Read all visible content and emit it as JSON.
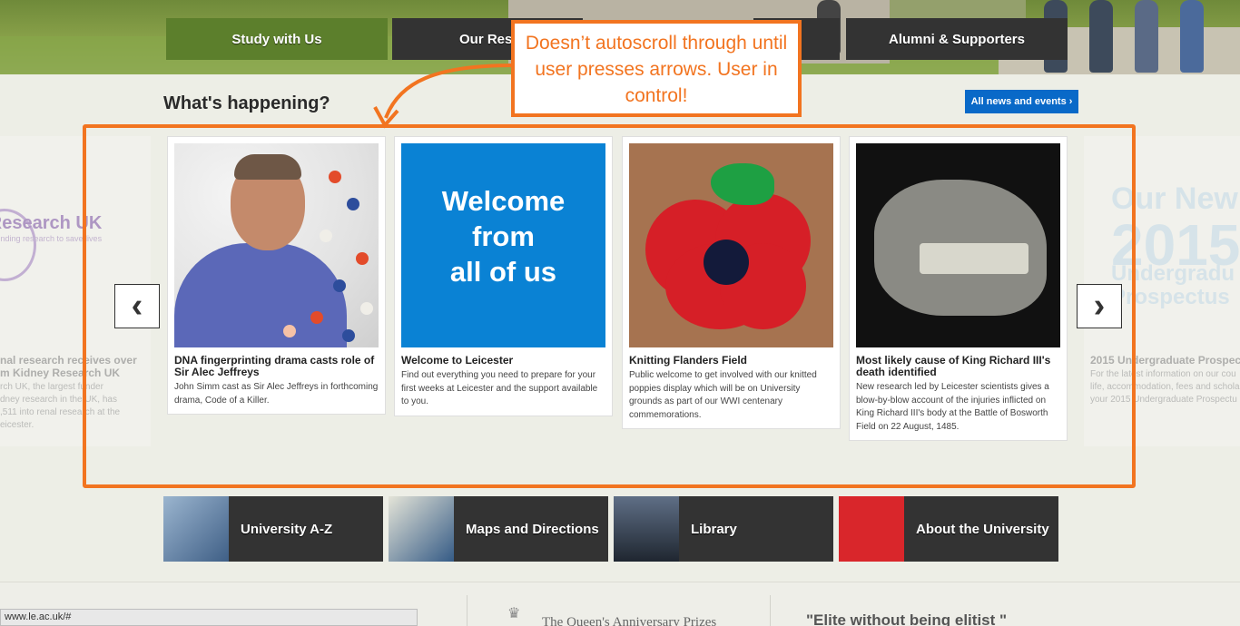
{
  "nav": {
    "study": "Study with Us",
    "research": "Our Res",
    "alumni": "Alumni & Supporters"
  },
  "section": {
    "title": "What's happening?",
    "all_news": "All news and events ›"
  },
  "carousel": {
    "prev_glyph": "‹",
    "next_glyph": "›",
    "ghost_left": {
      "logo": "ey Research UK",
      "logo_sub": "Funding research to save lives",
      "title": "nal research receives over\nm Kidney Research UK",
      "desc": "rch UK, the largest funder\ndney research in the UK, has\n,511 into renal research at the\neicester."
    },
    "ghost_right": {
      "big_lines": [
        "Our New",
        "2015",
        "Undergradu",
        "Prospectus"
      ],
      "title": "2015 Undergraduate Prospectu",
      "desc": "For the latest information on our cou\nlife, accommodation, fees and schola\nyour 2015 Undergraduate Prospectu"
    },
    "cards": [
      {
        "title": "DNA fingerprinting drama casts role of Sir Alec Jeffreys",
        "desc": "John Simm cast as Sir Alec Jeffreys in forthcoming drama, Code of a Killer."
      },
      {
        "image_text": [
          "Welcome",
          "from",
          "all of us"
        ],
        "title": "Welcome to Leicester",
        "desc": "Find out everything you need to prepare for your first weeks at Leicester and the support available to you."
      },
      {
        "title": "Knitting Flanders Field",
        "desc": "Public welcome to get involved with our knitted poppies display which will be on University grounds as part of our WWI centenary commemorations."
      },
      {
        "title": "Most likely cause of King Richard III's death identified",
        "desc": "New research led by Leicester scientists gives a blow-by-blow account of the injuries inflicted on King Richard III's body at the Battle of Bosworth Field on 22 August, 1485."
      }
    ]
  },
  "annotation": {
    "callout": "Doesn’t autoscroll through until user presses arrows. User in control!",
    "color": "#f27420"
  },
  "quick_links": [
    {
      "label": "University A-Z"
    },
    {
      "label": "Maps and Directions"
    },
    {
      "label": "Library"
    },
    {
      "label": "About the University"
    }
  ],
  "footer": {
    "status_url": "www.le.ac.uk/#",
    "prize": "The Queen's Anniversary Prizes",
    "quote": "\"Elite without being elitist \""
  },
  "colors": {
    "nav_active": "#5c7f2c",
    "nav_dark": "#333333",
    "button_blue": "#0969c8",
    "welcome_blue": "#0a82d4"
  }
}
